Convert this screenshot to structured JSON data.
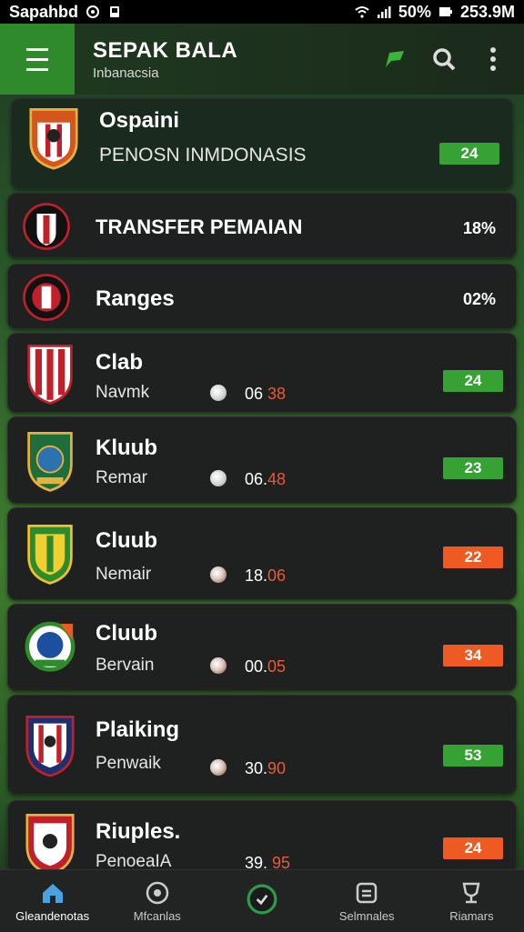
{
  "status": {
    "carrier": "Sapahbd",
    "battery": "50%",
    "time": "253.9M"
  },
  "app": {
    "title": "SEPAK BALA",
    "subtitle": "Inbanacsia"
  },
  "featured": {
    "title": "Ospaini",
    "subtitle": "PENOSN INMDONASIS",
    "badge": "24"
  },
  "items": [
    {
      "title": "TRANSFER PEMAIAN",
      "value": "18%"
    },
    {
      "title": "Ranges",
      "value": "02%"
    },
    {
      "title": "Clab",
      "sub": "Navmk",
      "score_a": "06",
      "score_b": "38",
      "badge": "24"
    },
    {
      "title": "Kluub",
      "sub": "Remar",
      "score_a": "06.",
      "score_b": "48",
      "badge": "23"
    },
    {
      "title": "Cluub",
      "sub": "Nemair",
      "score_a": "18.",
      "score_b": "06",
      "badge": "22"
    },
    {
      "title": "Cluub",
      "sub": "Bervain",
      "score_a": "00.",
      "score_b": "05",
      "badge": "34"
    },
    {
      "title": "Plaiking",
      "sub": "Penwaik",
      "score_a": "30.",
      "score_b": "90",
      "badge": "53"
    },
    {
      "title": "Riuples.",
      "sub": "PenoeaIA",
      "score_a": "39.",
      "score_b": "95",
      "badge": "24"
    }
  ],
  "nav": [
    {
      "label": "Gleandenotas",
      "icon": "home-icon"
    },
    {
      "label": "Mfcanlas",
      "icon": "ball-icon"
    },
    {
      "label": "",
      "icon": "check-icon"
    },
    {
      "label": "Selmnales",
      "icon": "list-icon"
    },
    {
      "label": "Riamars",
      "icon": "trophy-icon"
    }
  ],
  "colors": {
    "accent": "#2e8a2a",
    "badge_green": "#35a233",
    "badge_orange": "#ee5a22",
    "card": "#1f2120"
  }
}
